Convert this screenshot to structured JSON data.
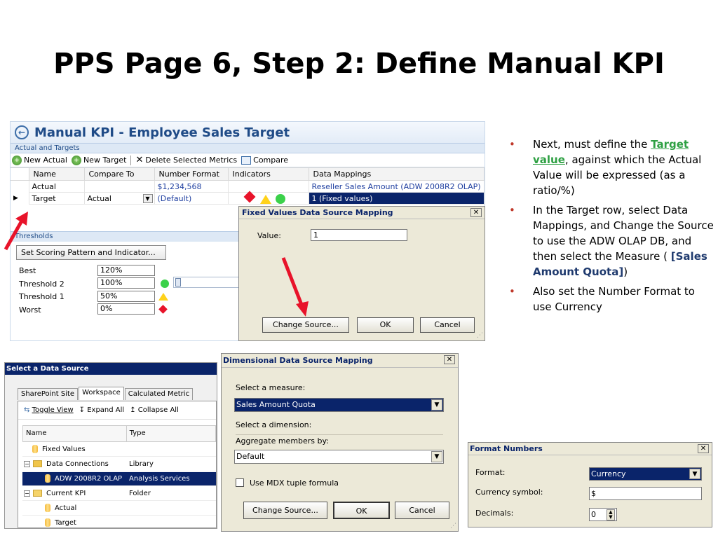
{
  "slide": {
    "title": "PPS Page 6, Step 2: Define Manual KPI"
  },
  "kpi_window": {
    "title": "Manual KPI - Employee Sales Target",
    "section": "Actual and Targets",
    "toolbar": {
      "new_actual": "New Actual",
      "new_target": "New Target",
      "delete": "Delete Selected Metrics",
      "compare": "Compare"
    },
    "columns": [
      "Name",
      "Compare To",
      "Number Format",
      "Indicators",
      "Data Mappings"
    ],
    "rows": [
      {
        "name": "Actual",
        "compare_to": "",
        "number_format": "$1,234,568",
        "data_mapping": "Reseller Sales Amount (ADW 2008R2 OLAP)"
      },
      {
        "name": "Target",
        "compare_to": "Actual",
        "number_format": "(Default)",
        "data_mapping": "1 (Fixed values)"
      }
    ],
    "thresholds_section": "Thresholds",
    "scoring_button": "Set Scoring Pattern and Indicator...",
    "thresholds": [
      {
        "label": "Best",
        "value": "120%"
      },
      {
        "label": "Threshold 2",
        "value": "100%"
      },
      {
        "label": "Threshold 1",
        "value": "50%"
      },
      {
        "label": "Worst",
        "value": "0%"
      }
    ]
  },
  "fixed_values_dialog": {
    "title": "Fixed Values Data Source Mapping",
    "value_label": "Value:",
    "value": "1",
    "change_source": "Change Source...",
    "ok": "OK",
    "cancel": "Cancel"
  },
  "bullets": {
    "b1_pre": "Next, must define the ",
    "b1_link": "Target value",
    "b1_post": ", against which the Actual Value will be expressed (as a ratio/%)",
    "b2_pre": "In the Target row, select Data Mappings, and Change the Source to use the ADW OLAP DB, and then select the Measure ( ",
    "b2_bold": "[Sales Amount Quota]",
    "b2_post": ")",
    "b3": "Also set the Number Format to use Currency"
  },
  "select_data_source": {
    "title": "Select a Data Source",
    "tabs": [
      "SharePoint Site",
      "Workspace",
      "Calculated Metric"
    ],
    "toolbar": {
      "toggle": "Toggle View",
      "expand": "Expand All",
      "collapse": "Collapse All"
    },
    "columns": [
      "Name",
      "Type"
    ],
    "rows": [
      {
        "name": "Fixed Values",
        "type": ""
      },
      {
        "name": "Data Connections",
        "type": "Library"
      },
      {
        "name": "ADW 2008R2 OLAP",
        "type": "Analysis Services"
      },
      {
        "name": "Current KPI",
        "type": "Folder"
      },
      {
        "name": "Actual",
        "type": ""
      },
      {
        "name": "Target",
        "type": ""
      }
    ]
  },
  "dimensional_dialog": {
    "title": "Dimensional Data Source Mapping",
    "measure_label": "Select a measure:",
    "measure_value": "Sales Amount Quota",
    "dimension_label": "Select a dimension:",
    "aggregate_label": "Aggregate members by:",
    "aggregate_value": "Default",
    "mdx_label": "Use MDX tuple formula",
    "change_source": "Change Source...",
    "ok": "OK",
    "cancel": "Cancel"
  },
  "format_dialog": {
    "title": "Format Numbers",
    "format_label": "Format:",
    "format_value": "Currency",
    "currency_label": "Currency symbol:",
    "currency_value": "$",
    "decimals_label": "Decimals:",
    "decimals_value": "0"
  },
  "colors": {
    "accent_link": "#2ea043",
    "selection": "#0a246a",
    "arrow": "#e8132a"
  }
}
